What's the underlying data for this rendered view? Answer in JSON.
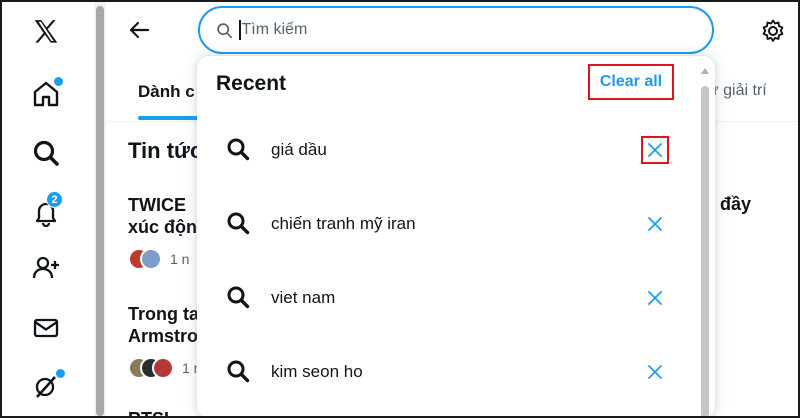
{
  "nav": {
    "items": [
      {
        "name": "x-logo-icon"
      },
      {
        "name": "home-icon"
      },
      {
        "name": "search-icon"
      },
      {
        "name": "notifications-icon",
        "badge": "2"
      },
      {
        "name": "follow-icon"
      },
      {
        "name": "messages-icon"
      },
      {
        "name": "grok-icon"
      }
    ]
  },
  "search": {
    "placeholder": "Tìm kiếm",
    "value": ""
  },
  "tabs": {
    "left_label": "Dành c",
    "right_label": "ư giải trí"
  },
  "main": {
    "section_title": "Tin tức",
    "news": [
      {
        "title_line1": "TWICE",
        "title_line2": "xúc động",
        "time": "1 n"
      },
      {
        "title_line1": "Trong ta",
        "title_line2": "Armstro",
        "time": "1 n"
      },
      {
        "title_line1": "RTSI",
        "title_line2": "",
        "time": ""
      }
    ],
    "right_word": "đầy"
  },
  "recent": {
    "title": "Recent",
    "clear_all": "Clear all",
    "items": [
      {
        "label": "giá dầu"
      },
      {
        "label": "chiến tranh mỹ iran"
      },
      {
        "label": "viet nam"
      },
      {
        "label": "kim seon ho"
      }
    ]
  },
  "colors": {
    "accent": "#1d9bf0",
    "highlight": "#e0141c",
    "text": "#0f1419",
    "muted": "#536471"
  }
}
